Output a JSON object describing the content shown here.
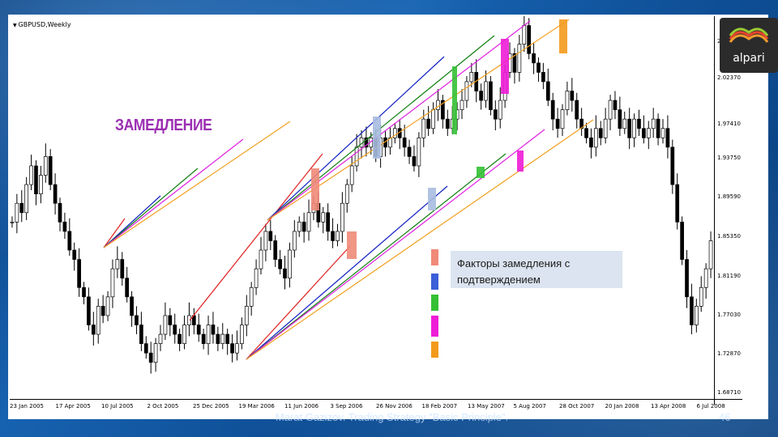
{
  "slide": {
    "footer": "Marat Gazizov. Trading Strategy \"Basic Principle\".",
    "page_number": "46"
  },
  "logo": {
    "text": "alpari",
    "icon": "wave-stripes-icon"
  },
  "chart": {
    "symbol": "GBPUSD,Weekly",
    "title": "ЗАМЕДЛЕНИЕ",
    "price_labels": [
      "2.06230",
      "2.02370",
      "1.97410",
      "1.93750",
      "1.89590",
      "1.85350",
      "1.81190",
      "1.77030",
      "1.72870",
      "1.68710"
    ],
    "date_labels": [
      "23 Jan 2005",
      "17 Apr 2005",
      "10 Jul 2005",
      "2 Oct 2005",
      "25 Dec 2005",
      "19 Mar 2006",
      "11 Jun 2006",
      "3 Sep 2006",
      "26 Nov 2006",
      "18 Feb 2007",
      "13 May 2007",
      "5 Aug 2007",
      "28 Oct 2007",
      "20 Jan 2008",
      "13 Apr 2008",
      "6 Jul 2008"
    ],
    "legend": {
      "text": "Факторы замедления с подтверждением",
      "swatch_colors": [
        "#f08a78",
        "#3a5fd8",
        "#34c034",
        "#ee1cd6",
        "#f39a1c"
      ]
    },
    "colors": {
      "red": "#e02020",
      "blue": "#1020c0",
      "green": "#108010",
      "magenta": "#e020e0",
      "orange": "#f0a020",
      "text_purple": "#9b2fb2"
    }
  },
  "chart_data": {
    "type": "candlestick",
    "title": "GBPUSD,Weekly",
    "y_ticks": [
      2.0623,
      2.0237,
      1.9741,
      1.9375,
      1.8959,
      1.8535,
      1.8119,
      1.7703,
      1.7287,
      1.6871
    ],
    "x_ticks": [
      "23 Jan 2005",
      "17 Apr 2005",
      "10 Jul 2005",
      "2 Oct 2005",
      "25 Dec 2005",
      "19 Mar 2006",
      "11 Jun 2006",
      "3 Sep 2006",
      "26 Nov 2006",
      "18 Feb 2007",
      "13 May 2007",
      "5 Aug 2007",
      "28 Oct 2007",
      "20 Jan 2008",
      "13 Apr 2008",
      "6 Jul 2008"
    ],
    "ylim": [
      1.68,
      2.09
    ],
    "series": [
      {
        "values": [
          1.87,
          1.89,
          1.88,
          1.91,
          1.93,
          1.9,
          1.92,
          1.94,
          1.91,
          1.89,
          1.87,
          1.86,
          1.84,
          1.83,
          1.8,
          1.79,
          1.76,
          1.75,
          1.78,
          1.77,
          1.79,
          1.82,
          1.83,
          1.81,
          1.79,
          1.77,
          1.76,
          1.74,
          1.73,
          1.72,
          1.74,
          1.75,
          1.77,
          1.76,
          1.75,
          1.74,
          1.76,
          1.77,
          1.76,
          1.75,
          1.74,
          1.76,
          1.75,
          1.74,
          1.75,
          1.74,
          1.73,
          1.74,
          1.76,
          1.78,
          1.8,
          1.82,
          1.84,
          1.86,
          1.85,
          1.83,
          1.82,
          1.81,
          1.84,
          1.86,
          1.87,
          1.86,
          1.88,
          1.89,
          1.87,
          1.88,
          1.86,
          1.85,
          1.86,
          1.89,
          1.91,
          1.93,
          1.95,
          1.96,
          1.95,
          1.96,
          1.94,
          1.96,
          1.95,
          1.96,
          1.97,
          1.96,
          1.95,
          1.94,
          1.93,
          1.96,
          1.98,
          1.97,
          1.99,
          2.0,
          1.98,
          1.97,
          1.98,
          1.99,
          2.0,
          2.02,
          2.03,
          2.01,
          2.0,
          2.02,
          1.99,
          1.98,
          2.0,
          2.03,
          2.05,
          2.03,
          2.06,
          2.08,
          2.05,
          2.04,
          2.03,
          2.02,
          2.0,
          1.98,
          1.97,
          1.99,
          2.01,
          2.0,
          1.98,
          1.97,
          1.96,
          1.95,
          1.97,
          1.96,
          1.98,
          2.0,
          1.99,
          1.97,
          1.98,
          1.96,
          1.98,
          1.97,
          1.96,
          1.97,
          1.98,
          1.96,
          1.97,
          1.95,
          1.91,
          1.87,
          1.83,
          1.79,
          1.76,
          1.78,
          1.8,
          1.82,
          1.85
        ]
      }
    ]
  }
}
